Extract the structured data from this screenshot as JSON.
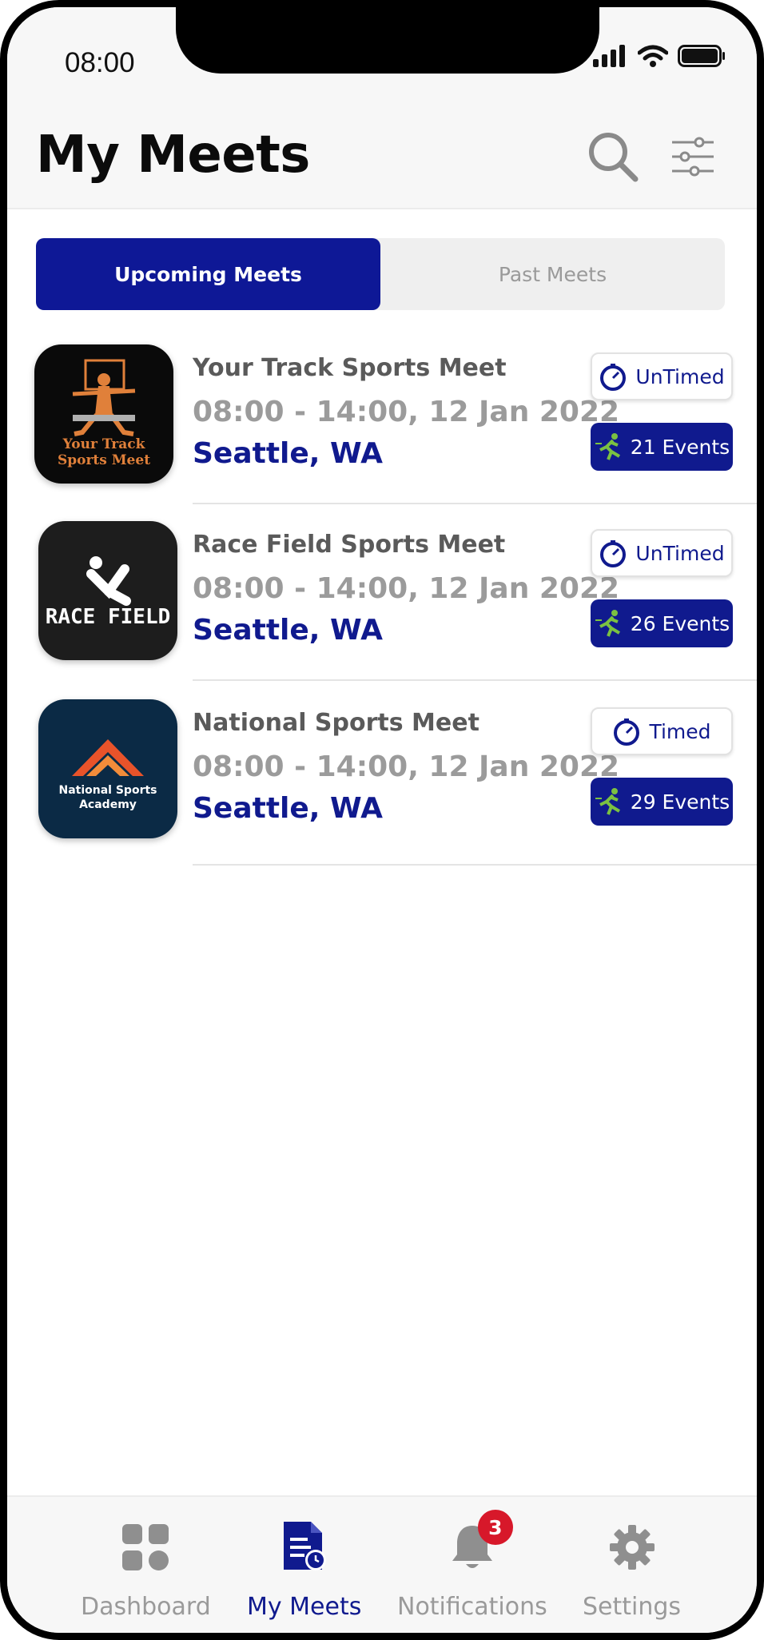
{
  "status_bar": {
    "time": "08:00"
  },
  "header": {
    "title": "My Meets"
  },
  "tabs": [
    {
      "label": "Upcoming Meets",
      "active": true
    },
    {
      "label": "Past Meets",
      "active": false
    }
  ],
  "meets": [
    {
      "name": "Your Track Sports Meet",
      "time": "08:00 - 14:00, 12 Jan 2022",
      "location": "Seattle, WA",
      "timing": "UnTimed",
      "events": "21 Events",
      "logo_text": [
        "Your Track",
        "Sports Meet"
      ]
    },
    {
      "name": "Race Field Sports Meet",
      "time": "08:00 - 14:00, 12 Jan 2022",
      "location": "Seattle, WA",
      "timing": "UnTimed",
      "events": "26 Events",
      "logo_text": [
        "RACE FIELD"
      ]
    },
    {
      "name": "National Sports Meet",
      "time": "08:00 - 14:00, 12 Jan 2022",
      "location": "Seattle, WA",
      "timing": "Timed",
      "events": "29 Events",
      "logo_text": [
        "National Sports",
        "Academy"
      ]
    }
  ],
  "bottom_nav": [
    {
      "label": "Dashboard",
      "icon": "dashboard-icon",
      "active": false
    },
    {
      "label": "My Meets",
      "icon": "my-meets-icon",
      "active": true
    },
    {
      "label": "Notifications",
      "icon": "bell-icon",
      "active": false,
      "badge": "3"
    },
    {
      "label": "Settings",
      "icon": "gear-icon",
      "active": false
    }
  ],
  "colors": {
    "primary": "#101a8e",
    "badge": "#d7182a",
    "muted": "#9a9a9a"
  }
}
